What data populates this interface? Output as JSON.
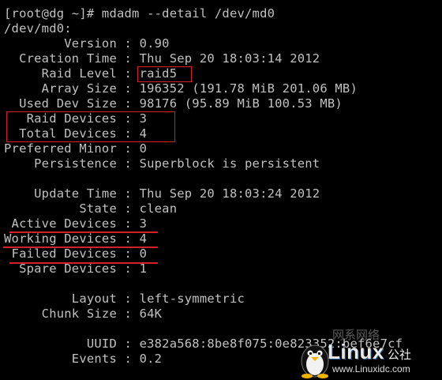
{
  "terminal": {
    "lines": [
      "[root@dg ~]# mdadm --detail /dev/md0",
      "/dev/md0:",
      "        Version : 0.90",
      "  Creation Time : Thu Sep 20 18:03:14 2012",
      "     Raid Level : raid5",
      "     Array Size : 196352 (191.78 MiB 201.06 MB)",
      "  Used Dev Size : 98176 (95.89 MiB 100.53 MB)",
      "   Raid Devices : 3",
      "  Total Devices : 4",
      "Preferred Minor : 0",
      "    Persistence : Superblock is persistent",
      "",
      "    Update Time : Thu Sep 20 18:03:24 2012",
      "          State : clean",
      " Active Devices : 3",
      "Working Devices : 4",
      " Failed Devices : 0",
      "  Spare Devices : 1",
      "",
      "         Layout : left-symmetric",
      "     Chunk Size : 64K",
      "",
      "           UUID : e382a568:8be8f075:0e823352:bef6e7cf",
      "         Events : 0.2"
    ]
  },
  "watermark": {
    "brand": "Linux",
    "brand_cn": "公社",
    "url": "www.Linuxidc.com",
    "top_text": "网系网络"
  },
  "colors": {
    "background": "#000000",
    "text": "#c0c0c0",
    "highlight": "#d0202a"
  }
}
